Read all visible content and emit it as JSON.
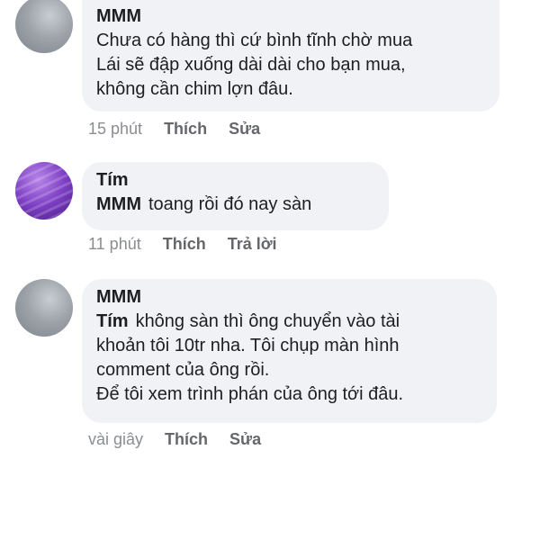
{
  "comments": [
    {
      "author": "MMM",
      "text": "Chưa có hàng thì cứ bình tĩnh chờ mua\nLái sẽ đập xuống dài dài cho bạn mua,\nkhông cần chim lợn đâu.",
      "mention": "",
      "avatar_icon": "profile-photo-grey",
      "time": "15 phút",
      "like_label": "Thích",
      "action_label": "Sửa"
    },
    {
      "author": "Tím",
      "mention": "MMM",
      "text": "toang rồi đó nay sàn",
      "avatar_icon": "profile-photo-purple-lavender",
      "time": "11 phút",
      "like_label": "Thích",
      "action_label": "Trả lời"
    },
    {
      "author": "MMM",
      "mention": "Tím",
      "text": "không sàn thì ông chuyển vào tài\nkhoản tôi 10tr nha. Tôi chụp màn hình\ncomment của ông rồi.\nĐể tôi xem trình phán của ông tới đâu.",
      "avatar_icon": "profile-photo-grey",
      "time": "vài giây",
      "like_label": "Thích",
      "action_label": "Sửa"
    }
  ],
  "colors": {
    "bubble": "#f0f2f5",
    "meta_text": "#65676b",
    "text": "#1c1e21"
  }
}
